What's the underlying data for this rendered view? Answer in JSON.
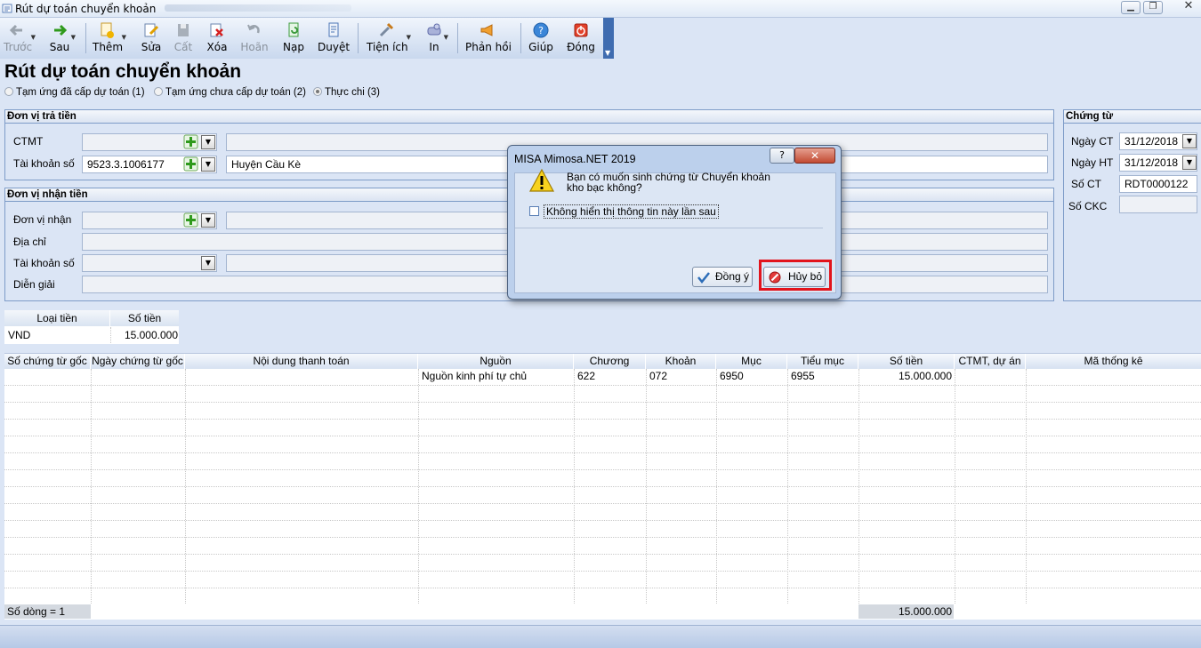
{
  "window": {
    "title": "Rút dự toán chuyển khoản",
    "controls": [
      "minimize",
      "restore",
      "close"
    ]
  },
  "toolbar": {
    "items": [
      {
        "label": "Trước",
        "icon": "arrow-left-icon",
        "disabled": true
      },
      {
        "label": "Sau",
        "icon": "arrow-right-icon",
        "disabled": false
      },
      {
        "label": "Thêm",
        "icon": "add-document-icon",
        "disabled": false
      },
      {
        "label": "Sửa",
        "icon": "edit-icon",
        "disabled": false
      },
      {
        "label": "Cất",
        "icon": "save-icon",
        "disabled": true
      },
      {
        "label": "Xóa",
        "icon": "delete-icon",
        "disabled": false
      },
      {
        "label": "Hoãn",
        "icon": "undo-icon",
        "disabled": true
      },
      {
        "label": "Nạp",
        "icon": "reload-icon",
        "disabled": false
      },
      {
        "label": "Duyệt",
        "icon": "approve-icon",
        "disabled": false
      },
      {
        "label": "Tiện ích",
        "icon": "tools-icon",
        "disabled": false
      },
      {
        "label": "In",
        "icon": "print-icon",
        "disabled": false
      },
      {
        "label": "Phản hồi",
        "icon": "megaphone-icon",
        "disabled": false
      },
      {
        "label": "Giúp",
        "icon": "help-icon",
        "disabled": false
      },
      {
        "label": "Đóng",
        "icon": "power-icon",
        "disabled": false
      }
    ]
  },
  "page": {
    "title": "Rút dự toán chuyển khoản",
    "radios": [
      {
        "label": "Tạm ứng đã cấp dự toán (1)",
        "selected": false
      },
      {
        "label": "Tạm ứng chưa cấp dự toán (2)",
        "selected": false
      },
      {
        "label": "Thực chi (3)",
        "selected": true
      }
    ]
  },
  "payer": {
    "header": "Đơn vị trả tiền",
    "ctmt_label": "CTMT",
    "ctmt_value": "",
    "ctmt_desc": "",
    "account_label": "Tài khoản số",
    "account_value": "9523.3.1006177",
    "account_desc": "Huyện Cầu Kè"
  },
  "payee": {
    "header": "Đơn vị nhận tiền",
    "unit_label": "Đơn vị nhận",
    "unit_value": "",
    "address_label": "Địa chỉ",
    "address_value": "",
    "account_label": "Tài khoản số",
    "account_value": "",
    "note_label": "Diễn giải",
    "note_value": ""
  },
  "voucher": {
    "header": "Chứng từ",
    "date_ct_label": "Ngày CT",
    "date_ct": "31/12/2018",
    "date_ht_label": "Ngày HT",
    "date_ht": "31/12/2018",
    "so_ct_label": "Số CT",
    "so_ct": "RDT0000122",
    "so_ckc_label": "Số CKC",
    "so_ckc": ""
  },
  "currency": {
    "headers": [
      "Loại tiền",
      "Số tiền"
    ],
    "rows": [
      [
        "VND",
        "15.000.000"
      ]
    ]
  },
  "grid": {
    "headers": [
      "Số chứng từ gốc",
      "Ngày chứng từ gốc",
      "Nội dung thanh toán",
      "Nguồn",
      "Chương",
      "Khoản",
      "Mục",
      "Tiểu mục",
      "Số tiền",
      "CTMT, dự án",
      "Mã thống kê"
    ],
    "rows": [
      [
        "",
        "",
        "",
        "Nguồn kinh phí tự chủ",
        "622",
        "072",
        "6950",
        "6955",
        "15.000.000",
        "",
        ""
      ]
    ],
    "footer_count": "Số dòng = 1",
    "footer_total": "15.000.000"
  },
  "dialog": {
    "title": "MISA Mimosa.NET 2019",
    "help_label": "?",
    "close_label": "✕",
    "message": "Bạn có muốn sinh chứng từ Chuyển khoản kho bạc không?",
    "checkbox_label": "Không hiển thị thông tin này lần sau",
    "checkbox_checked": false,
    "ok_label": "Đồng ý",
    "cancel_label": "Hủy bỏ",
    "highlight_color": "#e2141c"
  }
}
